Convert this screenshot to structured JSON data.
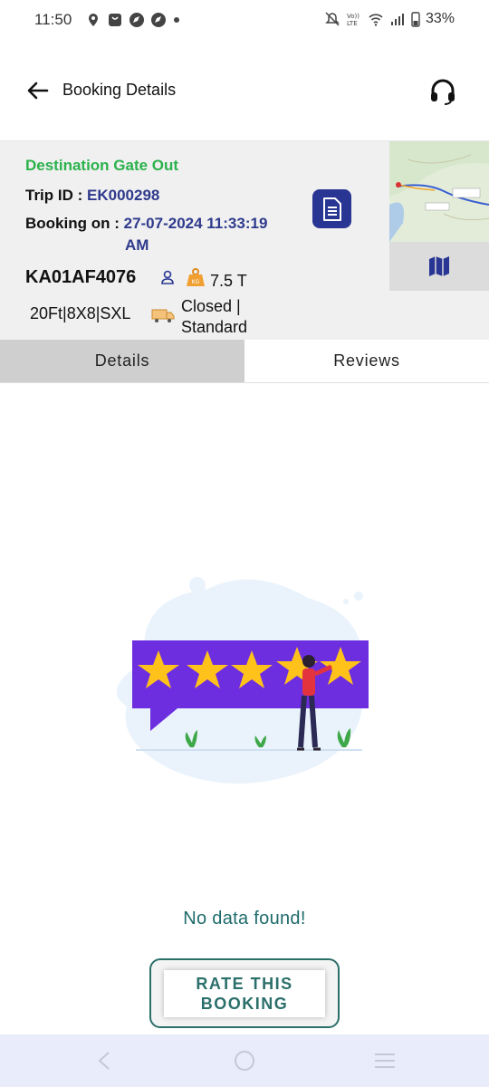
{
  "status_bar": {
    "time": "11:50",
    "battery": "33%",
    "left_icons": [
      "location-pin-icon",
      "bag-icon",
      "compass-icon",
      "compass-icon",
      "dot-icon"
    ],
    "right_icons": [
      "mute-icon",
      "volte-icon",
      "wifi-icon",
      "signal-icon",
      "battery-icon"
    ]
  },
  "header": {
    "title": "Booking Details",
    "back_icon": "arrow-left-icon",
    "support_icon": "headset-icon"
  },
  "trip": {
    "status": "Destination Gate Out",
    "trip_id_label": "Trip ID :",
    "trip_id": "EK000298",
    "booking_label": "Booking on :",
    "booking_date": "27-07-2024 11:33:19",
    "booking_time_suffix": "AM",
    "vehicle_no": "KA01AF4076",
    "weight": "7.5 T",
    "spec": "20Ft|8X8|SXL",
    "closed_line1": "Closed |",
    "closed_line2": "Standard"
  },
  "tabs": [
    {
      "label": "Details",
      "active": true
    },
    {
      "label": "Reviews",
      "active": false
    }
  ],
  "empty_state": {
    "message": "No data found!",
    "rate_line1": "RATE THIS",
    "rate_line2": "BOOKING"
  },
  "colors": {
    "status_green": "#2bb24c",
    "accent_navy": "#2e3a8c",
    "teal": "#2b6f6a",
    "purple": "#6d2ee0",
    "star": "#ffc21a"
  }
}
